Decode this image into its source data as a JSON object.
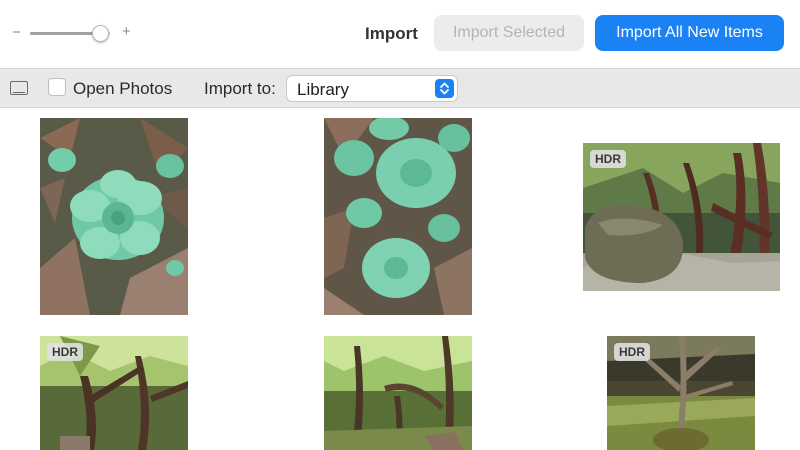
{
  "toolbar": {
    "zoom_minus": "−",
    "zoom_plus": "+",
    "import_label": "Import",
    "import_selected_label": "Import Selected",
    "import_all_label": "Import All New Items",
    "zoom_level": 0.88,
    "accent_color": "#1a82f5"
  },
  "subbar": {
    "device_icon": "device-icon",
    "open_photos_label": "Open Photos",
    "open_photos_checked": false,
    "import_to_label": "Import to:",
    "import_to_value": "Library"
  },
  "photos": [
    {
      "subject": "succulent rosette on leaves",
      "badge": ""
    },
    {
      "subject": "succulent rosettes on leaves",
      "badge": ""
    },
    {
      "subject": "forest with boulder",
      "badge": "HDR"
    },
    {
      "subject": "forest trees",
      "badge": "HDR"
    },
    {
      "subject": "forest trail",
      "badge": ""
    },
    {
      "subject": "bare tree on grass",
      "badge": "HDR"
    }
  ]
}
